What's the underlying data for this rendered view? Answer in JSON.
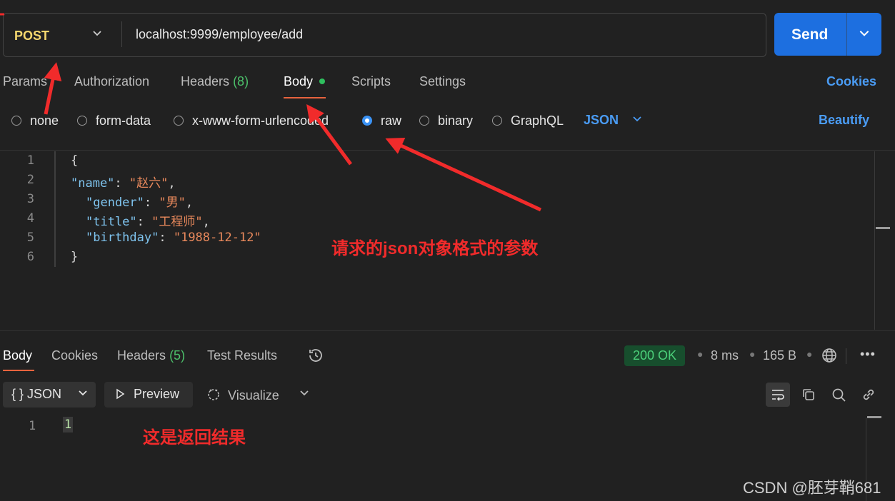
{
  "request": {
    "method": "POST",
    "url": "localhost:9999/employee/add",
    "send_label": "Send"
  },
  "request_tabs": {
    "params": "Params",
    "authorization": "Authorization",
    "headers": "Headers",
    "headers_count": "(8)",
    "body": "Body",
    "scripts": "Scripts",
    "settings": "Settings",
    "cookies": "Cookies"
  },
  "body_types": {
    "none": "none",
    "form_data": "form-data",
    "urlencoded": "x-www-form-urlencoded",
    "raw": "raw",
    "binary": "binary",
    "graphql": "GraphQL",
    "selected": "raw",
    "language": "JSON",
    "beautify": "Beautify"
  },
  "editor": {
    "line_numbers": [
      "1",
      "2",
      "3",
      "4",
      "5",
      "6"
    ],
    "open_brace": "{",
    "close_brace": "}",
    "fields": [
      {
        "key": "\"name\"",
        "value": "\"赵六\"",
        "trail": ","
      },
      {
        "key": "\"gender\"",
        "value": "\"男\"",
        "trail": ","
      },
      {
        "key": "\"title\"",
        "value": "\"工程师\"",
        "trail": ","
      },
      {
        "key": "\"birthday\"",
        "value": "\"1988-12-12\"",
        "trail": ""
      }
    ]
  },
  "response_tabs": {
    "body": "Body",
    "cookies": "Cookies",
    "headers": "Headers",
    "headers_count": "(5)",
    "test_results": "Test Results"
  },
  "response_meta": {
    "status": "200 OK",
    "time": "8 ms",
    "size": "165 B"
  },
  "response_toolbar": {
    "format": "JSON",
    "preview": "Preview",
    "visualize": "Visualize"
  },
  "response_body": {
    "line_number": "1",
    "value": "1"
  },
  "annotations": {
    "request_note": "请求的json对象格式的参数",
    "response_note": "这是返回结果",
    "color": "#f12b2b"
  },
  "watermark": "CSDN @胚芽鞘681",
  "colors": {
    "accent_blue": "#1d6fe0",
    "link_blue": "#4a9cf5",
    "method_yellow": "#f5d76e",
    "tab_underline": "#e8633e",
    "status_green": "#4cd07a"
  }
}
